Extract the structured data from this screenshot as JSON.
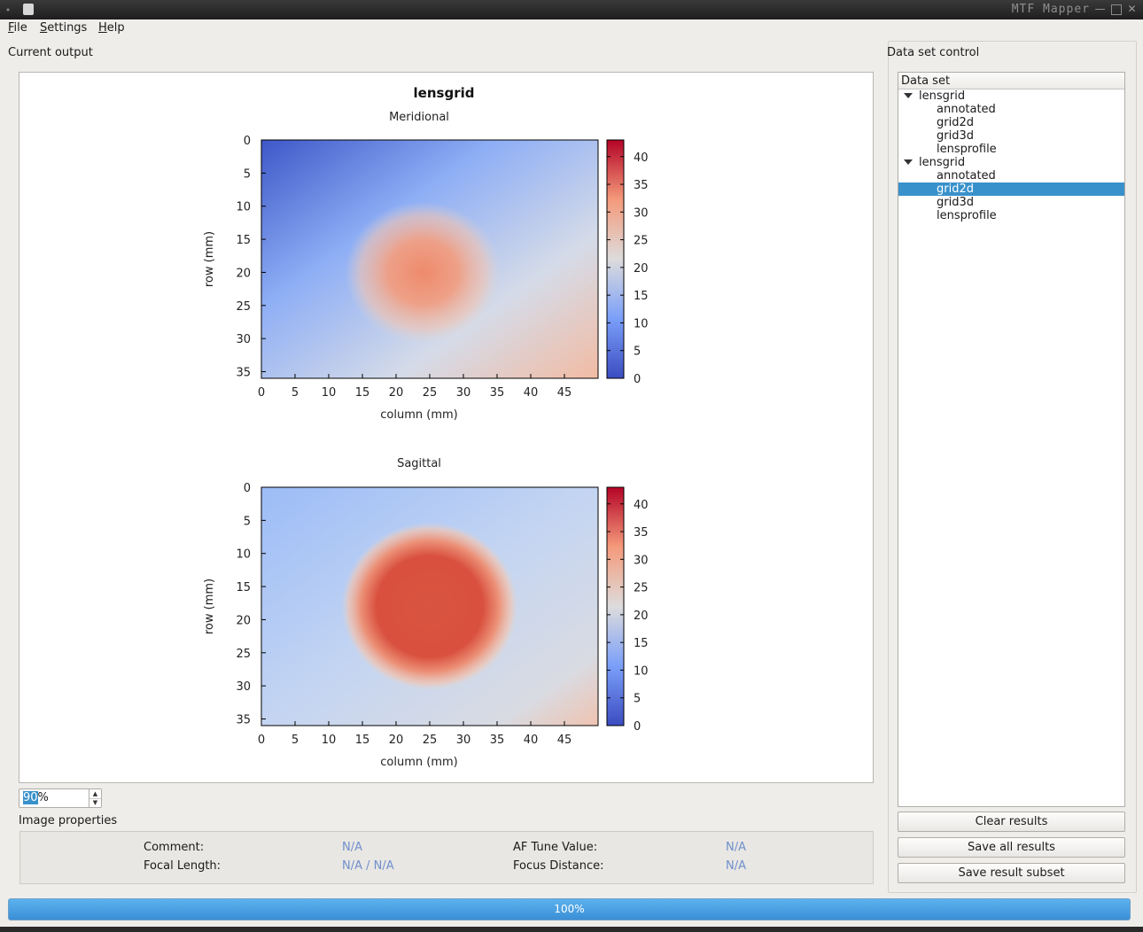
{
  "window": {
    "title": "MTF Mapper",
    "controls": [
      "minimize-icon",
      "maximize-icon",
      "close-icon"
    ]
  },
  "menu": {
    "items": [
      "File",
      "Settings",
      "Help"
    ]
  },
  "left": {
    "current_output_label": "Current output",
    "image_properties_label": "Image properties"
  },
  "plot": {
    "main_title": "lensgrid",
    "panels": [
      {
        "title": "Meridional",
        "xlabel": "column (mm)",
        "ylabel": "row (mm)"
      },
      {
        "title": "Sagittal",
        "xlabel": "column (mm)",
        "ylabel": "row (mm)"
      }
    ]
  },
  "chart_data": [
    {
      "type": "heatmap",
      "title": "Meridional",
      "xlabel": "column (mm)",
      "ylabel": "row (mm)",
      "x_ticks": [
        0,
        5,
        10,
        15,
        20,
        25,
        30,
        35,
        40,
        45
      ],
      "y_ticks": [
        0,
        5,
        10,
        15,
        20,
        25,
        30,
        35
      ],
      "xlim": [
        0,
        50
      ],
      "ylim": [
        0,
        36
      ],
      "colorbar_ticks": [
        0,
        5,
        10,
        15,
        20,
        25,
        30,
        35,
        40
      ],
      "colorbar_range": [
        0,
        43
      ],
      "peak": {
        "x": 24,
        "y": 20,
        "value": 30
      },
      "corner_values": {
        "top_left": 3,
        "top_right": 15,
        "bottom_left": 13,
        "bottom_right": 25
      }
    },
    {
      "type": "heatmap",
      "title": "Sagittal",
      "xlabel": "column (mm)",
      "ylabel": "row (mm)",
      "x_ticks": [
        0,
        5,
        10,
        15,
        20,
        25,
        30,
        35,
        40,
        45
      ],
      "y_ticks": [
        0,
        5,
        10,
        15,
        20,
        25,
        30,
        35
      ],
      "xlim": [
        0,
        50
      ],
      "ylim": [
        0,
        36
      ],
      "colorbar_ticks": [
        0,
        5,
        10,
        15,
        20,
        25,
        30,
        35,
        40
      ],
      "colorbar_range": [
        0,
        43
      ],
      "peak": {
        "x": 25,
        "y": 18,
        "value": 36
      },
      "corner_values": {
        "top_left": 12,
        "top_right": 15,
        "bottom_left": 14,
        "bottom_right": 20
      }
    }
  ],
  "zoom": {
    "value": "90",
    "suffix": "%"
  },
  "properties": {
    "comment_label": "Comment:",
    "comment_value": "N/A",
    "focal_label": "Focal Length:",
    "focal_value": "N/A / N/A",
    "af_label": "AF Tune Value:",
    "af_value": "N/A",
    "focus_label": "Focus Distance:",
    "focus_value": "N/A"
  },
  "dataset": {
    "label": "Data set control",
    "header": "Data set",
    "groups": [
      {
        "name": "lensgrid",
        "children": [
          "annotated",
          "grid2d",
          "grid3d",
          "lensprofile"
        ]
      },
      {
        "name": "lensgrid",
        "children": [
          "annotated",
          "grid2d",
          "grid3d",
          "lensprofile"
        ]
      }
    ],
    "selected": "grid2d"
  },
  "buttons": {
    "clear": "Clear results",
    "save_all": "Save all results",
    "save_subset": "Save result subset"
  },
  "progress": {
    "text": "100%",
    "value": 100
  }
}
